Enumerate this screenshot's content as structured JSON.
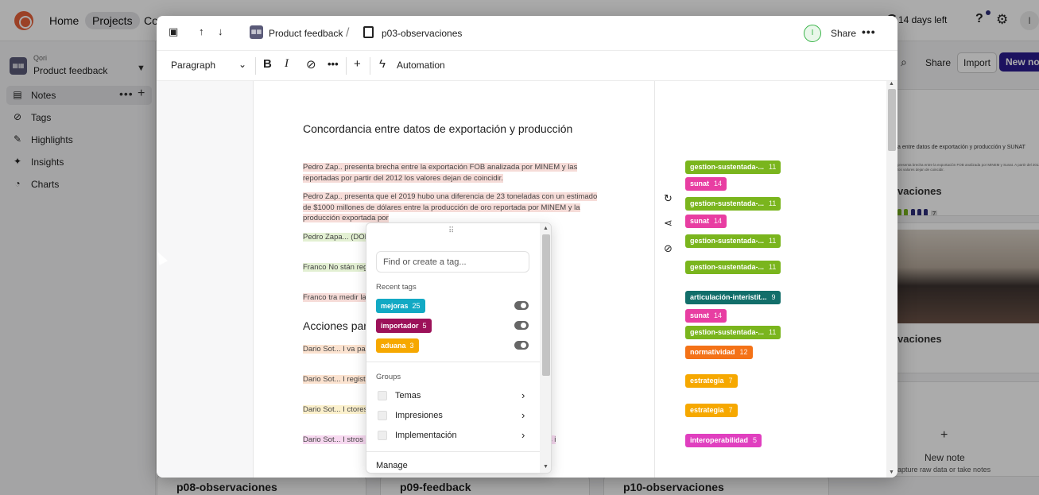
{
  "topnav": {
    "home": "Home",
    "projects": "Projects",
    "co": "Co",
    "trial": "14 days left",
    "avatar_initial": "I"
  },
  "sidebar": {
    "workspace_org": "Qori",
    "workspace_name": "Product feedback",
    "items": [
      {
        "label": "Notes",
        "icon": "note-icon"
      },
      {
        "label": "Tags",
        "icon": "tag-icon"
      },
      {
        "label": "Highlights",
        "icon": "highlighter-icon"
      },
      {
        "label": "Insights",
        "icon": "sparkle-icon"
      },
      {
        "label": "Charts",
        "icon": "chart-icon"
      }
    ]
  },
  "bg_header": {
    "share": "Share",
    "import": "Import",
    "new_note": "New note"
  },
  "bg_cards": {
    "card1_mini_title": "a entre datos de exportación y producción y SUNAT",
    "card1_mini_text": "presenta brecha entre la exportación FOB analizada por MINEM y Sunat. A partir del 2012 los valores dejan de coincidir.",
    "card1_title": "vaciones",
    "card1_count": "7",
    "card2_title": "vaciones",
    "new_note_title": "New note",
    "new_note_sub": "apture raw data or take notes"
  },
  "bottom_cards": [
    "p08-observaciones",
    "p09-feedback",
    "p10-observaciones"
  ],
  "modal": {
    "crumb_project": "Product feedback",
    "crumb_sep": "/",
    "crumb_doc": "p03-observaciones",
    "avatar_initial": "I",
    "share": "Share",
    "toolbar": {
      "paragraph": "Paragraph",
      "automation": "Automation"
    },
    "doc": {
      "heading1": "Concordancia entre datos de exportación y producción",
      "heading2": "Acciones par",
      "paragraphs": [
        {
          "text": "Pedro Zap..            presenta brecha entre la  exportación FOB analizada  por MINEM y las reportadas por               partir del 2012 los valores dejan de coincidir.",
          "hl": "hl-pink"
        },
        {
          "text": "Pedro Zap..            presenta que el  2019 hubo una diferencia de 23 toneladas con un estimado de $1000 millones de dólares entre la producción de oro reportada por MINEM y la producción exportada por",
          "hl": "hl-pink"
        },
        {
          "text": "Pedro Zapa... (DOFI                                                       exportado se está relacionado co                                                              ros.",
          "hl": "hl-green"
        },
        {
          "text": "Franco                No                                                              stán registrando como",
          "hl": "hl-green"
        },
        {
          "text": "Franco                tra                                                              medir la brecha entre produ",
          "hl": "hl-pink"
        },
        {
          "text": "Dario Sot...           I                                                               va para establecer el mane",
          "hl": "hl-peach"
        },
        {
          "text": "Dario Sot...           I                                                               registro en el comprador y no ta",
          "hl": "hl-peach"
        },
        {
          "text": "Dario Sot...           I                                                               ctores y transparentar toda",
          "hl": "hl-yellow"
        },
        {
          "text": "Dario Sot...           I                                                               stros de mineros en vías de                                                            conversen con sistemas de otras i",
          "hl": "hl-mag"
        }
      ]
    },
    "tags": [
      {
        "label": "gestion-sustentada-...",
        "count": "11",
        "color": "#7ab51d"
      },
      {
        "label": "sunat",
        "count": "14",
        "color": "#e83ea2"
      },
      {
        "label": "gestion-sustentada-...",
        "count": "11",
        "color": "#7ab51d"
      },
      {
        "label": "sunat",
        "count": "14",
        "color": "#e83ea2"
      },
      {
        "label": "gestion-sustentada-...",
        "count": "11",
        "color": "#7ab51d"
      },
      {
        "label": "gestion-sustentada-...",
        "count": "11",
        "color": "#7ab51d"
      },
      {
        "label": "articulación-interistit...",
        "count": "9",
        "color": "#126e6a"
      },
      {
        "label": "sunat",
        "count": "14",
        "color": "#e83ea2"
      },
      {
        "label": "gestion-sustentada-...",
        "count": "11",
        "color": "#7ab51d"
      },
      {
        "label": "normatividad",
        "count": "12",
        "color": "#f47217"
      },
      {
        "label": "estrategia",
        "count": "7",
        "color": "#f6a800"
      },
      {
        "label": "estrategia",
        "count": "7",
        "color": "#f6a800"
      },
      {
        "label": "interoperabilidad",
        "count": "5",
        "color": "#e03fbf"
      }
    ]
  },
  "popover": {
    "search_placeholder": "Find or create a tag...",
    "recent_label": "Recent tags",
    "recent": [
      {
        "label": "mejoras",
        "count": "25",
        "color": "#12a9c4"
      },
      {
        "label": "importador",
        "count": "5",
        "color": "#9c1159"
      },
      {
        "label": "aduana",
        "count": "3",
        "color": "#f6a800"
      }
    ],
    "groups_label": "Groups",
    "groups": [
      "Temas",
      "Impresiones",
      "Implementación"
    ],
    "manage": "Manage"
  }
}
